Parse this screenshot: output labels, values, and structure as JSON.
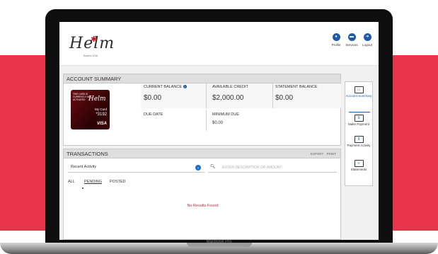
{
  "laptop": {
    "label": "MacBook Pro"
  },
  "header": {
    "logo": "Helm",
    "logo_sub": "Bases USA",
    "nav": [
      {
        "label": "Profile",
        "icon": "person-icon"
      },
      {
        "label": "Services",
        "icon": "card-icon"
      },
      {
        "label": "Logout",
        "icon": "logout-icon"
      }
    ]
  },
  "account_summary": {
    "title": "ACCOUNT SUMMARY",
    "card": {
      "status": "THIS CARD IS CURRENTLY NOT ACTIVATED",
      "logo": "Helm",
      "name": "My Card",
      "number": "*3192",
      "network": "VISA"
    },
    "current_balance_label": "CURRENT BALANCE",
    "current_balance": "$0.00",
    "available_credit_label": "AVAILABLE CREDIT",
    "available_credit": "$2,000.00",
    "statement_balance_label": "STATEMENT BALANCE",
    "statement_balance": "$0.00",
    "due_date_label": "DUE DATE",
    "minimum_due_label": "MINIMUM DUE",
    "minimum_due": "$0.00"
  },
  "transactions": {
    "title": "TRANSACTIONS",
    "export_label": "EXPORT",
    "print_label": "PRINT",
    "filter_value": "Recent Activity",
    "search_placeholder": "ENTER DESCRIPTION OR AMOUNT",
    "tabs": [
      "ALL",
      "PENDING",
      "POSTED"
    ],
    "active_tab": "PENDING",
    "empty_message": "No Results Found"
  },
  "sidebar": {
    "items": [
      {
        "label": "Account Summary",
        "icon": "account-summary-icon"
      },
      {
        "label": "Make Payment",
        "icon": "make-payment-icon"
      },
      {
        "label": "Payment Activity",
        "icon": "payment-activity-icon"
      },
      {
        "label": "Statements",
        "icon": "statements-icon"
      }
    ]
  },
  "colors": {
    "brand_red": "#e8334a",
    "accent_blue": "#1f5aa6",
    "error_red": "#d42030"
  }
}
